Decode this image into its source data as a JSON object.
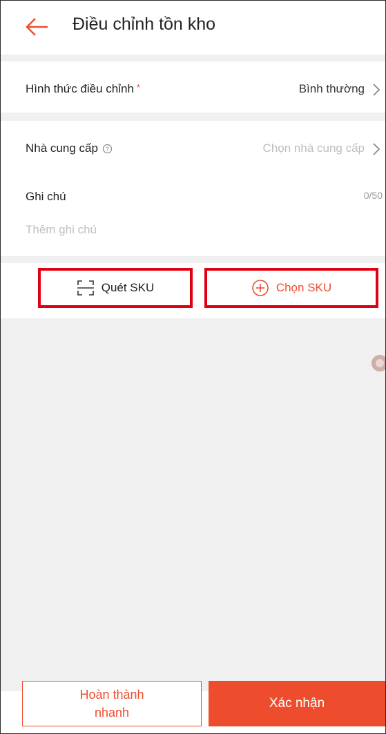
{
  "header": {
    "title": "Điều chỉnh tồn kho",
    "back_icon": "arrow-left-icon"
  },
  "form": {
    "adjust_type": {
      "label": "Hình thức điều chỉnh",
      "required_mark": "*",
      "value": "Bình thường"
    },
    "supplier": {
      "label": "Nhà cung cấp",
      "placeholder": "Chọn nhà cung cấp"
    },
    "note": {
      "label": "Ghi chú",
      "count": "0/50",
      "placeholder": "Thêm ghi chú"
    }
  },
  "actions": {
    "scan_sku": "Quét SKU",
    "choose_sku": "Chọn SKU"
  },
  "footer": {
    "quick_complete": "Hoàn thành nhanh",
    "confirm": "Xác nhận"
  },
  "colors": {
    "accent": "#ee4d2d",
    "highlight_border": "#e00012",
    "background": "#f0f0f0"
  }
}
